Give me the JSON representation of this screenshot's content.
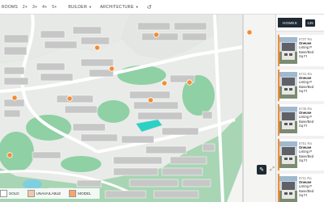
{
  "filters": {
    "bedrooms_label": "ROOMS",
    "bedroom_options": [
      "2+",
      "3+",
      "4+",
      "5+"
    ],
    "builder_label": "BUILDER",
    "architecture_label": "ARCHITECTURE",
    "reset_icon": "reset-icon"
  },
  "panel": {
    "tab_homes": "HOMES",
    "tab_count": "125",
    "cards": [
      {
        "address": "5737 Ra",
        "community": "Oneuse",
        "status": "Listing P",
        "type": "Base/Bed",
        "size": "Sq Ft"
      },
      {
        "address": "5741 Ra",
        "community": "Oneuse",
        "status": "Listing P",
        "type": "Base/Bed",
        "size": "Sq Ft"
      },
      {
        "address": "5745 Ra",
        "community": "Oneuse",
        "status": "Listing P",
        "type": "Base/Bed",
        "size": "Sq Ft"
      },
      {
        "address": "5751 Ra",
        "community": "Oneuse",
        "status": "Listing P",
        "type": "Base/Bed",
        "size": "Sq Ft"
      },
      {
        "address": "5711 Ra",
        "community": "Oneuse",
        "status": "Listing P",
        "type": "Base/Bed",
        "size": "Sq Ft"
      }
    ]
  },
  "legend": [
    {
      "label": "SOLD",
      "color": "#ffffff"
    },
    {
      "label": "UNAVAILABLE",
      "color": "#f3c8a8"
    },
    {
      "label": "MODEL",
      "color": "#f7a66a"
    }
  ],
  "colors": {
    "accent": "#f28c2f",
    "dark": "#1f2a33",
    "park": "#7fc79a",
    "lot": "#c9c9c9"
  },
  "map_controls": {
    "expand": "expand-icon",
    "draw": "pencil-icon"
  }
}
